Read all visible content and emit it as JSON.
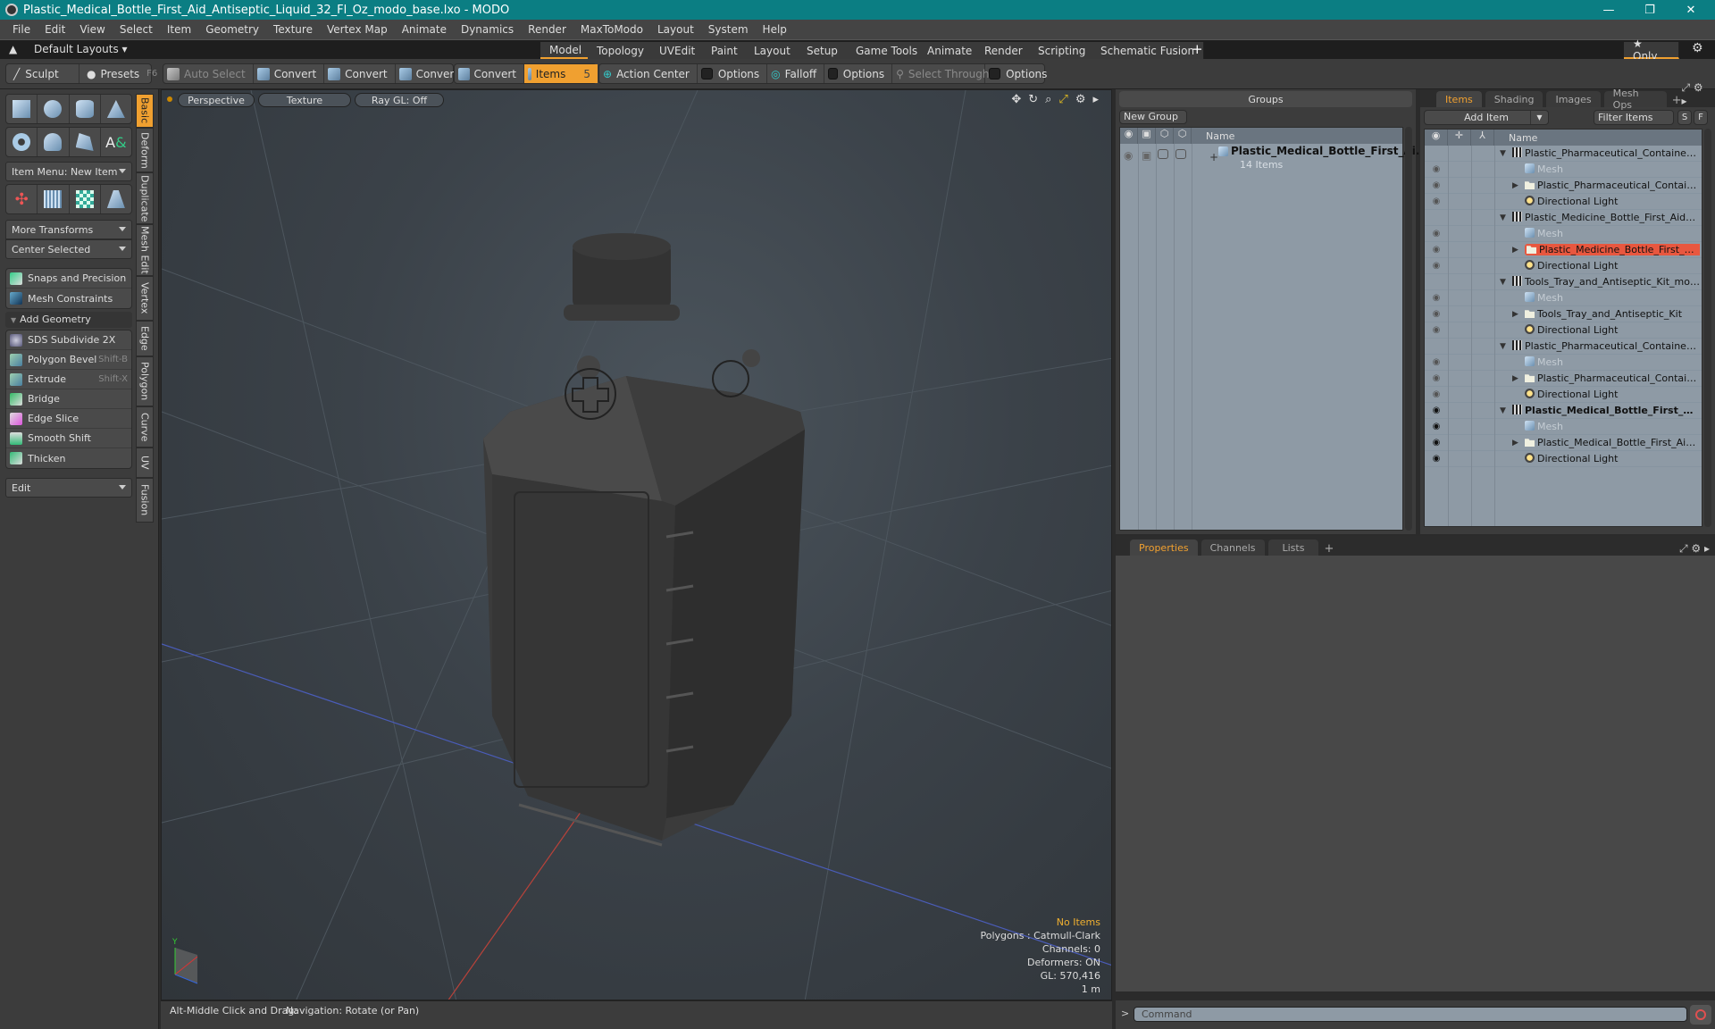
{
  "window": {
    "title": "Plastic_Medical_Bottle_First_Aid_Antiseptic_Liquid_32_Fl_Oz_modo_base.lxo - MODO",
    "controls": {
      "minimize": "—",
      "maximize": "❐",
      "close": "✕"
    }
  },
  "menu": [
    "File",
    "Edit",
    "View",
    "Select",
    "Item",
    "Geometry",
    "Texture",
    "Vertex Map",
    "Animate",
    "Dynamics",
    "Render",
    "MaxToModo",
    "Layout",
    "System",
    "Help"
  ],
  "layoutbar": {
    "default_layouts": "Default Layouts ▾",
    "tabs": [
      "Model",
      "Topology",
      "UVEdit",
      "Paint",
      "Layout",
      "Setup",
      "Game Tools",
      "Animate",
      "Render",
      "Scripting",
      "Schematic Fusion"
    ],
    "active_tab": "Model",
    "add": "+",
    "only": "★ Only",
    "gear": "⚙"
  },
  "toolbar": {
    "sculpt": "Sculpt",
    "presets": "Presets",
    "presets_key": "F6",
    "auto_select": "Auto Select",
    "convert": "Convert",
    "items": "Items",
    "items_count": "5",
    "action_center": "Action Center",
    "options": "Options",
    "falloff": "Falloff",
    "select_through": "Select Through"
  },
  "leftpanel": {
    "item_menu": "Item Menu: New Item",
    "more_transforms": "More Transforms",
    "center_selected": "Center Selected",
    "snaps": "Snaps and Precision",
    "constraints": "Mesh Constraints",
    "add_geometry": "Add Geometry",
    "geometry_tools": [
      {
        "label": "SDS Subdivide 2X",
        "shortcut": ""
      },
      {
        "label": "Polygon Bevel",
        "shortcut": "Shift-B"
      },
      {
        "label": "Extrude",
        "shortcut": "Shift-X"
      },
      {
        "label": "Bridge",
        "shortcut": ""
      },
      {
        "label": "Edge Slice",
        "shortcut": ""
      },
      {
        "label": "Smooth Shift",
        "shortcut": ""
      },
      {
        "label": "Thicken",
        "shortcut": ""
      }
    ],
    "edit": "Edit",
    "vtabs": [
      "Basic",
      "Deform",
      "Duplicate",
      "Mesh Edit",
      "Vertex",
      "Edge",
      "Polygon",
      "Curve",
      "UV",
      "Fusion"
    ]
  },
  "viewport": {
    "view": "Perspective",
    "shading": "Texture",
    "raygl": "Ray GL: Off",
    "hud": {
      "selection": "No Items",
      "polygons": "Polygons : Catmull-Clark",
      "channels": "Channels: 0",
      "deformers": "Deformers: ON",
      "gl": "GL: 570,416",
      "scale": "1 m"
    }
  },
  "status": {
    "hint_key": "Alt-Middle Click and Drag:",
    "hint_action": "Navigation: Rotate (or Pan)"
  },
  "groups": {
    "title": "Groups",
    "new_group": "New Group",
    "name_header": "Name",
    "entry_name": "Plastic_Medical_Bottle_First_Ai...",
    "entry_count": "14 Items"
  },
  "items": {
    "tabs": [
      "Items",
      "Shading",
      "Images",
      "Mesh Ops"
    ],
    "active_tab": "Items",
    "add_item": "Add Item",
    "filter": "Filter Items",
    "s": "S",
    "f": "F",
    "name_header": "Name",
    "rows": [
      {
        "type": "scene",
        "name": "Plastic_Pharmaceutical_Container_W ...",
        "level": 0,
        "eye": "",
        "state": ""
      },
      {
        "type": "mesh",
        "name": "Mesh",
        "level": 1,
        "eye": "◉",
        "state": "dim"
      },
      {
        "type": "group",
        "name": "Plastic_Pharmaceutical_Container_...",
        "level": 1,
        "eye": "◉",
        "state": ""
      },
      {
        "type": "light",
        "name": "Directional Light",
        "level": 1,
        "eye": "◉",
        "state": ""
      },
      {
        "type": "scene",
        "name": "Plastic_Medicine_Bottle_First_Aid_An...",
        "level": 0,
        "eye": "",
        "state": ""
      },
      {
        "type": "mesh",
        "name": "Mesh",
        "level": 1,
        "eye": "◉",
        "state": "dim"
      },
      {
        "type": "group",
        "name": "Plastic_Medicine_Bottle_First_Aid_...",
        "level": 1,
        "eye": "◉",
        "state": "selected"
      },
      {
        "type": "light",
        "name": "Directional Light",
        "level": 1,
        "eye": "◉",
        "state": ""
      },
      {
        "type": "scene",
        "name": "Tools_Tray_and_Antiseptic_Kit_modo...",
        "level": 0,
        "eye": "",
        "state": ""
      },
      {
        "type": "mesh",
        "name": "Mesh",
        "level": 1,
        "eye": "◉",
        "state": "dim"
      },
      {
        "type": "group",
        "name": "Tools_Tray_and_Antiseptic_Kit",
        "level": 1,
        "eye": "◉",
        "state": ""
      },
      {
        "type": "light",
        "name": "Directional Light",
        "level": 1,
        "eye": "◉",
        "state": ""
      },
      {
        "type": "scene",
        "name": "Plastic_Pharmaceutical_Container_Br ...",
        "level": 0,
        "eye": "",
        "state": ""
      },
      {
        "type": "mesh",
        "name": "Mesh",
        "level": 1,
        "eye": "◉",
        "state": "dim"
      },
      {
        "type": "group",
        "name": "Plastic_Pharmaceutical_Container_...",
        "level": 1,
        "eye": "◉",
        "state": ""
      },
      {
        "type": "light",
        "name": "Directional Light",
        "level": 1,
        "eye": "◉",
        "state": ""
      },
      {
        "type": "scene",
        "name": "Plastic_Medical_Bottle_First_Ai...",
        "level": 0,
        "eye": "◉",
        "state": "bold"
      },
      {
        "type": "mesh",
        "name": "Mesh",
        "level": 1,
        "eye": "◉",
        "state": "dim-active"
      },
      {
        "type": "group",
        "name": "Plastic_Medical_Bottle_First_Aid_A...",
        "level": 1,
        "eye": "◉",
        "state": "active"
      },
      {
        "type": "light",
        "name": "Directional Light",
        "level": 1,
        "eye": "◉",
        "state": "active"
      }
    ]
  },
  "properties": {
    "tabs": [
      "Properties",
      "Channels",
      "Lists"
    ],
    "active_tab": "Properties"
  },
  "command": {
    "prompt": ">",
    "placeholder": "Command"
  },
  "colors": {
    "accent": "#f0a030",
    "titlebar": "#0b7e83",
    "selection": "#e8573f"
  }
}
